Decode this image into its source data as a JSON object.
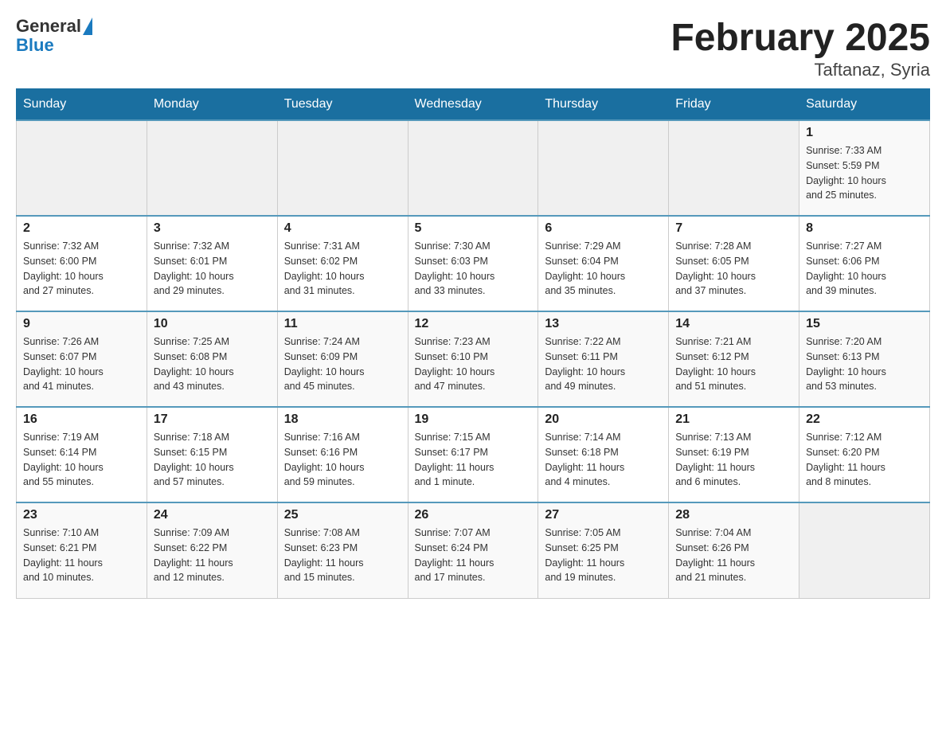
{
  "header": {
    "logo": {
      "general": "General",
      "blue": "Blue"
    },
    "title": "February 2025",
    "location": "Taftanaz, Syria"
  },
  "days_of_week": [
    "Sunday",
    "Monday",
    "Tuesday",
    "Wednesday",
    "Thursday",
    "Friday",
    "Saturday"
  ],
  "weeks": [
    [
      {
        "day": "",
        "info": ""
      },
      {
        "day": "",
        "info": ""
      },
      {
        "day": "",
        "info": ""
      },
      {
        "day": "",
        "info": ""
      },
      {
        "day": "",
        "info": ""
      },
      {
        "day": "",
        "info": ""
      },
      {
        "day": "1",
        "info": "Sunrise: 7:33 AM\nSunset: 5:59 PM\nDaylight: 10 hours\nand 25 minutes."
      }
    ],
    [
      {
        "day": "2",
        "info": "Sunrise: 7:32 AM\nSunset: 6:00 PM\nDaylight: 10 hours\nand 27 minutes."
      },
      {
        "day": "3",
        "info": "Sunrise: 7:32 AM\nSunset: 6:01 PM\nDaylight: 10 hours\nand 29 minutes."
      },
      {
        "day": "4",
        "info": "Sunrise: 7:31 AM\nSunset: 6:02 PM\nDaylight: 10 hours\nand 31 minutes."
      },
      {
        "day": "5",
        "info": "Sunrise: 7:30 AM\nSunset: 6:03 PM\nDaylight: 10 hours\nand 33 minutes."
      },
      {
        "day": "6",
        "info": "Sunrise: 7:29 AM\nSunset: 6:04 PM\nDaylight: 10 hours\nand 35 minutes."
      },
      {
        "day": "7",
        "info": "Sunrise: 7:28 AM\nSunset: 6:05 PM\nDaylight: 10 hours\nand 37 minutes."
      },
      {
        "day": "8",
        "info": "Sunrise: 7:27 AM\nSunset: 6:06 PM\nDaylight: 10 hours\nand 39 minutes."
      }
    ],
    [
      {
        "day": "9",
        "info": "Sunrise: 7:26 AM\nSunset: 6:07 PM\nDaylight: 10 hours\nand 41 minutes."
      },
      {
        "day": "10",
        "info": "Sunrise: 7:25 AM\nSunset: 6:08 PM\nDaylight: 10 hours\nand 43 minutes."
      },
      {
        "day": "11",
        "info": "Sunrise: 7:24 AM\nSunset: 6:09 PM\nDaylight: 10 hours\nand 45 minutes."
      },
      {
        "day": "12",
        "info": "Sunrise: 7:23 AM\nSunset: 6:10 PM\nDaylight: 10 hours\nand 47 minutes."
      },
      {
        "day": "13",
        "info": "Sunrise: 7:22 AM\nSunset: 6:11 PM\nDaylight: 10 hours\nand 49 minutes."
      },
      {
        "day": "14",
        "info": "Sunrise: 7:21 AM\nSunset: 6:12 PM\nDaylight: 10 hours\nand 51 minutes."
      },
      {
        "day": "15",
        "info": "Sunrise: 7:20 AM\nSunset: 6:13 PM\nDaylight: 10 hours\nand 53 minutes."
      }
    ],
    [
      {
        "day": "16",
        "info": "Sunrise: 7:19 AM\nSunset: 6:14 PM\nDaylight: 10 hours\nand 55 minutes."
      },
      {
        "day": "17",
        "info": "Sunrise: 7:18 AM\nSunset: 6:15 PM\nDaylight: 10 hours\nand 57 minutes."
      },
      {
        "day": "18",
        "info": "Sunrise: 7:16 AM\nSunset: 6:16 PM\nDaylight: 10 hours\nand 59 minutes."
      },
      {
        "day": "19",
        "info": "Sunrise: 7:15 AM\nSunset: 6:17 PM\nDaylight: 11 hours\nand 1 minute."
      },
      {
        "day": "20",
        "info": "Sunrise: 7:14 AM\nSunset: 6:18 PM\nDaylight: 11 hours\nand 4 minutes."
      },
      {
        "day": "21",
        "info": "Sunrise: 7:13 AM\nSunset: 6:19 PM\nDaylight: 11 hours\nand 6 minutes."
      },
      {
        "day": "22",
        "info": "Sunrise: 7:12 AM\nSunset: 6:20 PM\nDaylight: 11 hours\nand 8 minutes."
      }
    ],
    [
      {
        "day": "23",
        "info": "Sunrise: 7:10 AM\nSunset: 6:21 PM\nDaylight: 11 hours\nand 10 minutes."
      },
      {
        "day": "24",
        "info": "Sunrise: 7:09 AM\nSunset: 6:22 PM\nDaylight: 11 hours\nand 12 minutes."
      },
      {
        "day": "25",
        "info": "Sunrise: 7:08 AM\nSunset: 6:23 PM\nDaylight: 11 hours\nand 15 minutes."
      },
      {
        "day": "26",
        "info": "Sunrise: 7:07 AM\nSunset: 6:24 PM\nDaylight: 11 hours\nand 17 minutes."
      },
      {
        "day": "27",
        "info": "Sunrise: 7:05 AM\nSunset: 6:25 PM\nDaylight: 11 hours\nand 19 minutes."
      },
      {
        "day": "28",
        "info": "Sunrise: 7:04 AM\nSunset: 6:26 PM\nDaylight: 11 hours\nand 21 minutes."
      },
      {
        "day": "",
        "info": ""
      }
    ]
  ]
}
